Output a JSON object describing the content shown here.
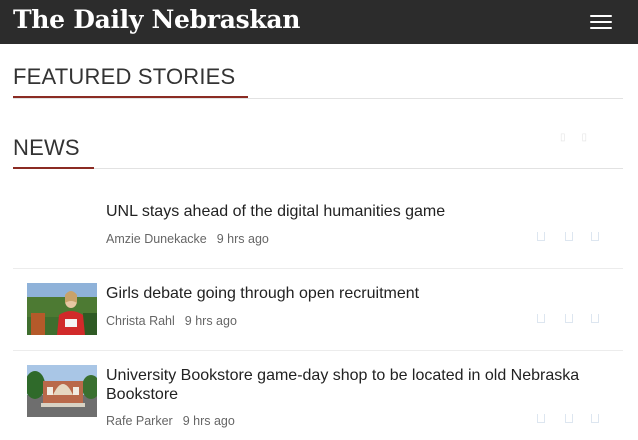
{
  "header": {
    "logo_text": "The Daily Nebraskan",
    "menu_icon": "hamburger-menu-icon",
    "background": "#2c2c2c"
  },
  "sections": {
    "featured_title": "FEATURED STORIES",
    "news_title": "NEWS",
    "accent_color": "#8b2b23"
  },
  "stories": [
    {
      "headline": "UNL stays ahead of the digital humanities game",
      "author": "Amzie Dunekacke",
      "time": "9 hrs ago",
      "has_thumbnail": false
    },
    {
      "headline": "Girls debate going through open recruitment",
      "author": "Christa Rahl",
      "time": "9 hrs ago",
      "has_thumbnail": true,
      "thumbnail_icon": "student-photo"
    },
    {
      "headline": "University Bookstore game-day shop to be located in old Nebraska Bookstore",
      "author": "Rafe Parker",
      "time": "9 hrs ago",
      "has_thumbnail": true,
      "thumbnail_icon": "bookstore-photo"
    }
  ]
}
